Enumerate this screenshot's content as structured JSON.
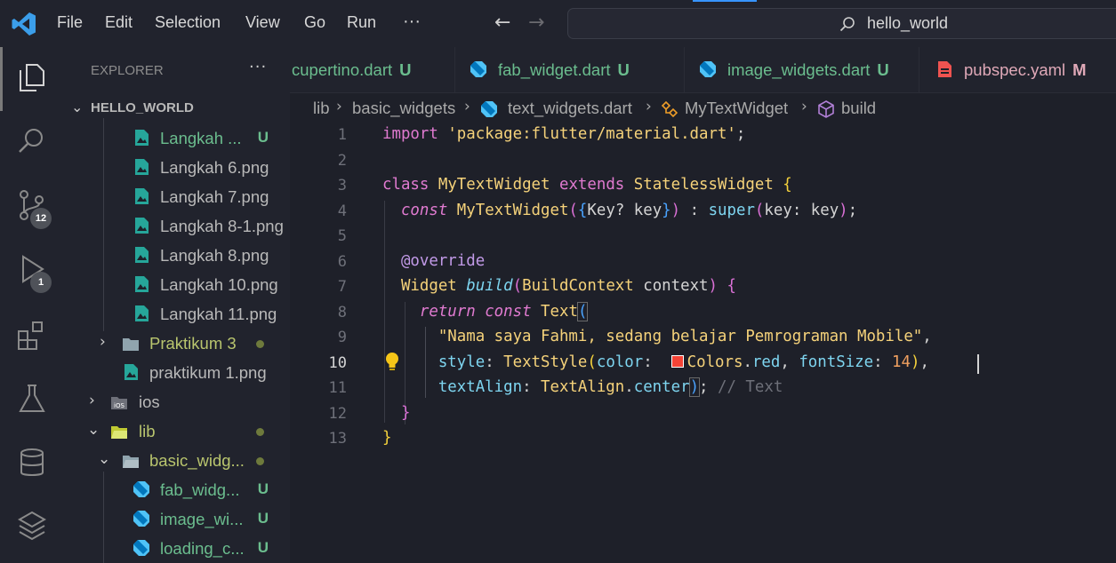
{
  "menu": [
    "File",
    "Edit",
    "Selection",
    "View",
    "Go",
    "Run",
    "···"
  ],
  "command_center": {
    "label": "hello_world",
    "icon": "search-icon"
  },
  "activity_bar": {
    "items": [
      {
        "name": "explorer-icon"
      },
      {
        "name": "search-icon"
      },
      {
        "name": "source-control-icon",
        "badge": "12"
      },
      {
        "name": "run-debug-icon",
        "badge": "1"
      },
      {
        "name": "extensions-icon"
      },
      {
        "name": "testing-icon"
      },
      {
        "name": "database-icon"
      },
      {
        "name": "layers-icon"
      }
    ]
  },
  "sidebar": {
    "title": "EXPLORER",
    "more": "···",
    "root": "HELLO_WORLD",
    "items": [
      {
        "label": "Langkah ...",
        "status": "U",
        "type": "image"
      },
      {
        "label": "Langkah 6.png",
        "status": "",
        "type": "image"
      },
      {
        "label": "Langkah 7.png",
        "status": "",
        "type": "image"
      },
      {
        "label": "Langkah 8-1.png",
        "status": "",
        "type": "image"
      },
      {
        "label": "Langkah 8.png",
        "status": "",
        "type": "image"
      },
      {
        "label": "Langkah 10.png",
        "status": "",
        "type": "image"
      },
      {
        "label": "Langkah 11.png",
        "status": "",
        "type": "image"
      },
      {
        "label": "Praktikum 3",
        "status": "",
        "type": "folder"
      },
      {
        "label": "praktikum 1.png",
        "status": "",
        "type": "image"
      },
      {
        "label": "ios",
        "status": "",
        "type": "folder-ios"
      },
      {
        "label": "lib",
        "status": "",
        "type": "folder-lib"
      },
      {
        "label": "basic_widg...",
        "status": "",
        "type": "folder"
      },
      {
        "label": "fab_widg...",
        "status": "U",
        "type": "dart"
      },
      {
        "label": "image_wi...",
        "status": "U",
        "type": "dart"
      },
      {
        "label": "loading_c...",
        "status": "U",
        "type": "dart"
      }
    ]
  },
  "tabs": [
    {
      "label": "cupertino.dart",
      "status": "U"
    },
    {
      "label": "fab_widget.dart",
      "status": "U"
    },
    {
      "label": "image_widgets.dart",
      "status": "U"
    },
    {
      "label": "pubspec.yaml",
      "status": "M"
    }
  ],
  "breadcrumb": [
    "lib",
    "basic_widgets",
    "text_widgets.dart",
    "MyTextWidget",
    "build"
  ],
  "editor": {
    "line_numbers": [
      "1",
      "2",
      "3",
      "4",
      "5",
      "6",
      "7",
      "8",
      "9",
      "10",
      "11",
      "12",
      "13"
    ],
    "active_line": "10",
    "lines": {
      "l1_kw": "import",
      "l1_str": "'package:flutter/material.dart'",
      "l1_end": ";",
      "l3_class": "class",
      "l3_name": "MyTextWidget",
      "l3_extends": "extends",
      "l3_parent": "StatelessWidget",
      "l3_brace": "{",
      "l4_const": "const",
      "l4_name": "MyTextWidget",
      "l4_p1": "(",
      "l4_b": "{",
      "l4_key": "Key? key",
      "l4_b2": "}",
      "l4_p2": ")",
      "l4_colon": " : ",
      "l4_super": "super",
      "l4_args": "key: key",
      "l4_end": ";",
      "l6_ann": "@override",
      "l7_type": "Widget",
      "l7_fn": "build",
      "l7_param": "BuildContext context",
      "l7_brace": "{",
      "l8_return": "return",
      "l8_const": "const",
      "l8_text": "Text",
      "l8_paren": "(",
      "l9_str": "\"Nama saya Fahmi, sedang belajar Pemrograman Mobile\"",
      "l9_comma": ",",
      "l10_style": "style",
      "l10_ts": "TextStyle",
      "l10_color": "color",
      "l10_colors": "Colors",
      "l10_red": "red",
      "l10_fs": "fontSize",
      "l10_num": "14",
      "l11_ta": "textAlign",
      "l11_cls": "TextAlign",
      "l11_center": "center",
      "l11_comment": "// Text",
      "l12_brace": "}",
      "l13_brace": "}"
    }
  },
  "colors": {
    "background": "#1e2029",
    "chrome": "#21232d",
    "untracked": "#6bbd8e",
    "modified": "#e0a9b8",
    "keyword": "#e07ad0",
    "string": "#f5d27a",
    "type": "#7ed5f0",
    "color_swatch": "#f44336"
  }
}
